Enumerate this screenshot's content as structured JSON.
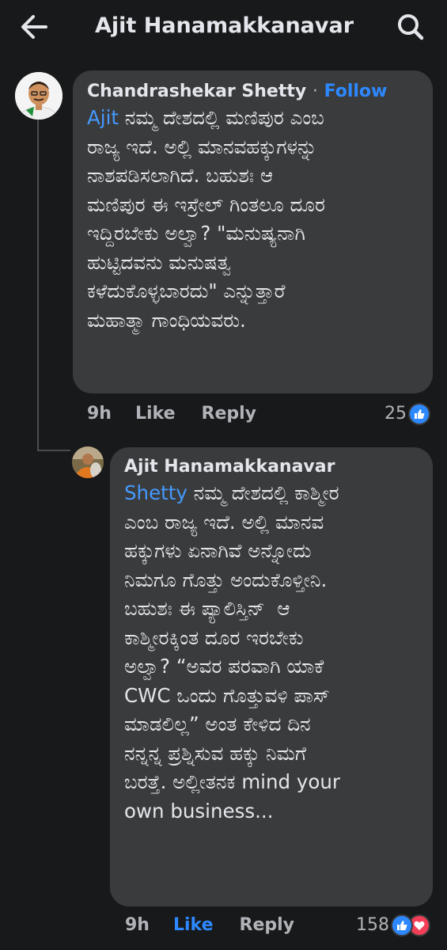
{
  "header": {
    "title": "Ajit Hanamakkanavar"
  },
  "comments": [
    {
      "author": "Chandrashekar Shetty",
      "separator": "·",
      "follow_label": "Follow",
      "mention": "Ajit",
      "text": "ನಮ್ಮ ದೇಶದಲ್ಲಿ ಮಣಿಪುರ ಎಂಬ\nರಾಜ್ಯ ಇದೆ. ಅಲ್ಲಿ ಮಾನವಹಕ್ಕುಗಳನ್ನು\nನಾಶಪಡಿಸಲಾಗಿದೆ. ಬಹುಶಃ ಆ\nಮಣಿಪುರ ಈ ಇಸ್ರೇಲ್ ಗಿಂತಲೂ ದೂರ\nಇದ್ದಿರಬೇಕು ಅಲ್ವಾ? \"ಮನುಷ್ಯನಾಗಿ\nಹುಟ್ಟಿದವನು ಮನುಷತ್ವ\nಕಳೆದುಕೊಳ್ಳಬಾರದು\" ಎನ್ನುತ್ತಾರೆ\nಮಹಾತ್ಮಾ ಗಾಂಧಿಯವರು.",
      "time": "9h",
      "like_label": "Like",
      "reply_label": "Reply",
      "reaction_count": "25"
    },
    {
      "author": "Ajit Hanamakkanavar",
      "mention": "Shetty",
      "text": "ನಮ್ಮ ದೇಶದಲ್ಲಿ ಕಾಶ್ಮೀರ\nಎಂಬ ರಾಜ್ಯ ಇದೆ. ಅಲ್ಲಿ ಮಾನವ\nಹಕ್ಕುಗಳು ಏನಾಗಿವೆ ಅನ್ನೋದು\nನಿಮಗೂ ಗೊತ್ತು ಅಂದುಕೊಳ್ತೀನಿ.\nಬಹುಶಃ ಈ ಪ್ಯಾಲಿಸ್ತಿನ್  ಆ\nಕಾಶ್ಮೀರಕ್ಕಿಂತ ದೂರ ಇರಬೇಕು\nಅಲ್ವಾ? “ಅವರ ಪರವಾಗಿ ಯಾಕೆ\nCWC ಒಂದು ಗೊತ್ತುವಳಿ ಪಾಸ್\nಮಾಡಲಿಲ್ಲ” ಅಂತ ಕೇಳಿದ ದಿನ\nನನ್ನನ್ನ ಪ್ರಶ್ನಿಸುವ ಹಕ್ಕು ನಿಮಗೆ\nಬರತ್ತೆ. ಅಲ್ಲೀತನಕ mind your\nown business...",
      "time": "9h",
      "like_label": "Like",
      "reply_label": "Reply",
      "reaction_count": "158"
    }
  ],
  "colors": {
    "background": "#18191a",
    "bubble": "#3a3b3c",
    "link_blue": "#2d88ff",
    "love_red": "#f33e58"
  }
}
